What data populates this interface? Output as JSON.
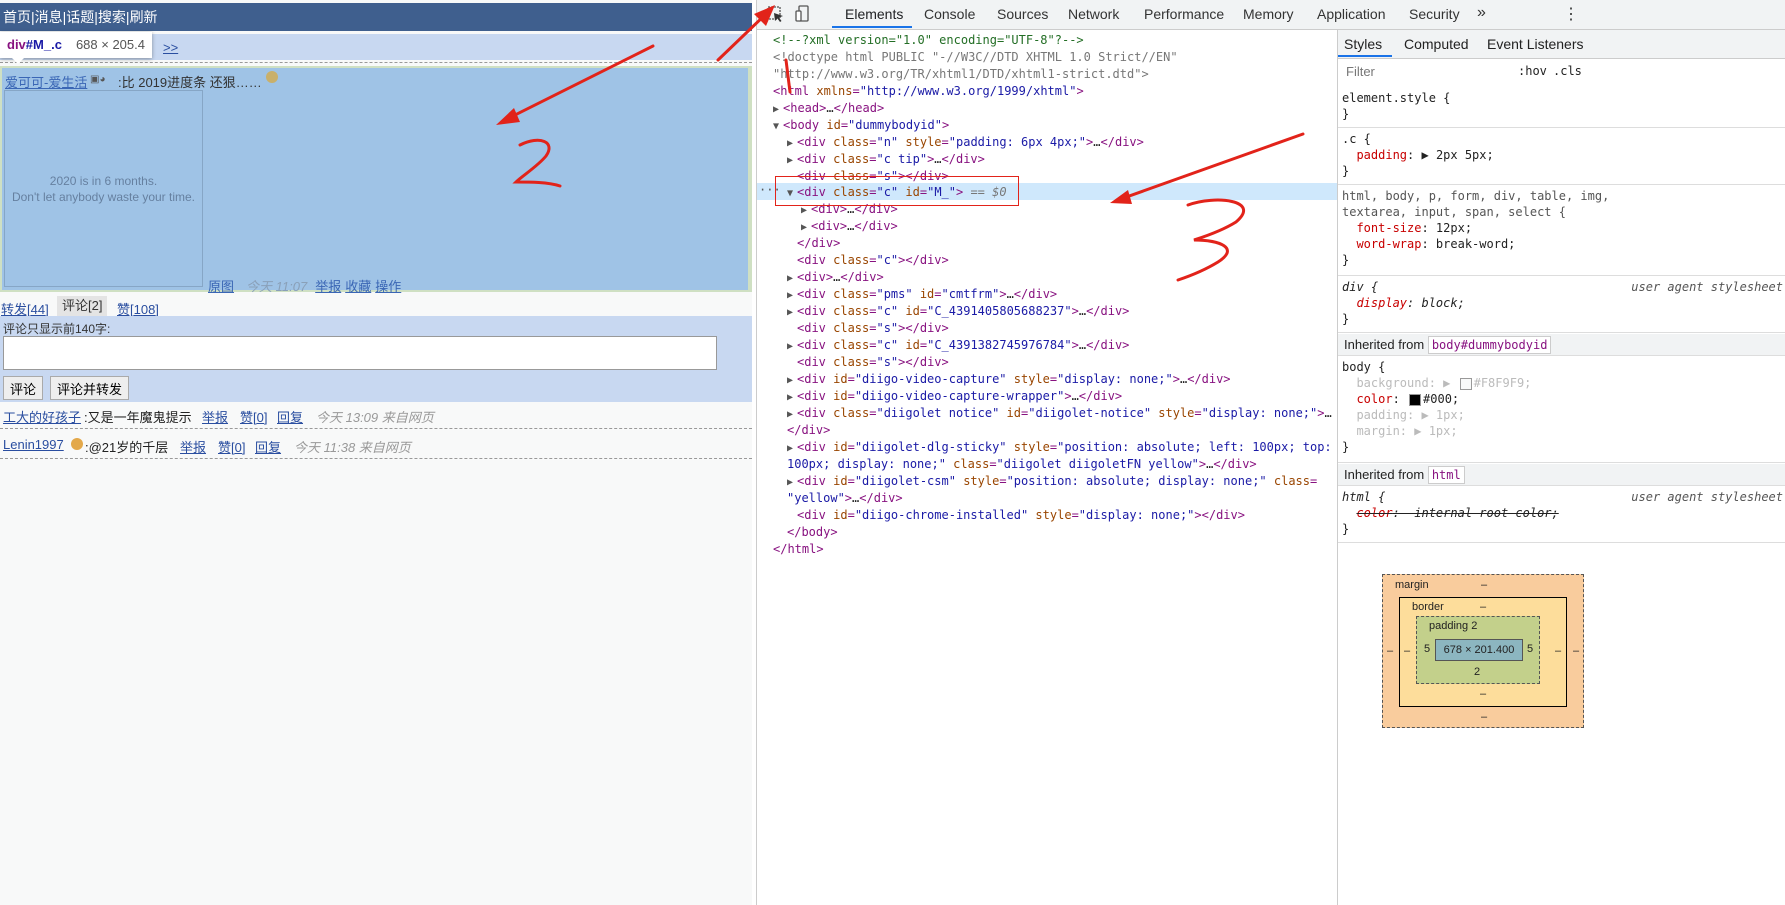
{
  "webpage": {
    "nav": [
      "首页",
      "消息",
      "话题",
      "搜索",
      "刷新"
    ],
    "nav_sep": "|",
    "tip_link": ">>",
    "tooltip": {
      "tag": "div",
      "id": "#M_.c",
      "dims": "688 × 205.4"
    },
    "post": {
      "user": "爱可可-爱生活",
      "text": ":比 2019进度条 还狠……",
      "image_text_1": "2020 is in 6 months.",
      "image_text_2": "Don't let anybody waste your time.",
      "orig_link": "原图",
      "time": "今天 11:07",
      "report": "举报",
      "fav": "收藏",
      "ops": "操作"
    },
    "actions": {
      "repost": "转发[44]",
      "comment": "评论[2]",
      "like": "赞[108]"
    },
    "comment_box": {
      "limit_text": "评论只显示前140字:",
      "btn_comment": "评论",
      "btn_comment_repost": "评论并转发"
    },
    "comments": [
      {
        "user": "工大的好孩子",
        "text": ":又是一年魔鬼提示",
        "report": "举报",
        "like": "赞[0]",
        "reply": "回复",
        "time": "今天 13:09 来自网页"
      },
      {
        "user": "Lenin1997",
        "text": ":@21岁的千层",
        "report": "举报",
        "like": "赞[0]",
        "reply": "回复",
        "time": "今天 11:38 来自网页"
      }
    ]
  },
  "devtools": {
    "tabs": [
      "Elements",
      "Console",
      "Sources",
      "Network",
      "Performance",
      "Memory",
      "Application",
      "Security"
    ],
    "more": "»",
    "kebab": "⋮",
    "dom_lines": {
      "l1": "<!--?xml version=\"1.0\" encoding=\"UTF-8\"?-->",
      "l2": "<!doctype html PUBLIC \"-//W3C//DTD XHTML 1.0 Strict//EN\"",
      "l3": "\"http://www.w3.org/TR/xhtml1/DTD/xhtml1-strict.dtd\">",
      "sel_suffix": " == $0"
    },
    "styles_tabs": [
      "Styles",
      "Computed",
      "Event Listeners"
    ],
    "filter_placeholder": "Filter",
    "hov": ":hov",
    "cls": ".cls",
    "inherited_label": "Inherited from",
    "inherited_body": "body#dummybodyid",
    "inherited_html": "html",
    "ua_label": "user agent stylesheet",
    "box_model": {
      "margin_label": "margin",
      "border_label": "border",
      "padding_label": "padding 2",
      "content": "678 × 201.400",
      "dash": "–",
      "pad_left": "5",
      "pad_right": "5",
      "pad_bottom": "2"
    }
  },
  "annotations": {
    "n1": "1",
    "n2": "2",
    "n3": "3"
  },
  "colors": {
    "nav_bg": "#3f5f8e",
    "post_bg": "#9fc3e6",
    "comment_box_bg": "#c8d8f1",
    "accent": "#1a73e8",
    "annotation": "#e2231a"
  }
}
